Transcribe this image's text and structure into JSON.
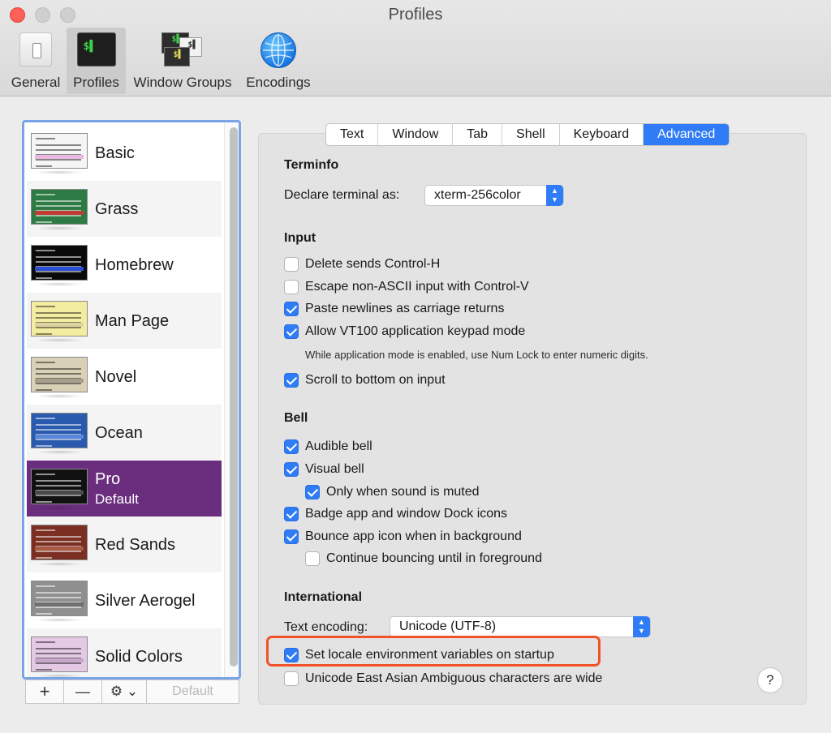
{
  "window": {
    "title": "Profiles"
  },
  "toolbar": [
    {
      "label": "General",
      "icon": "general-switch-icon"
    },
    {
      "label": "Profiles",
      "icon": "terminal-profile-icon",
      "selected": true
    },
    {
      "label": "Window Groups",
      "icon": "window-groups-icon"
    },
    {
      "label": "Encodings",
      "icon": "globe-icon"
    }
  ],
  "profiles": [
    {
      "name": "Basic",
      "bg": "#f5f5f5",
      "hl": "#e9b8e0"
    },
    {
      "name": "Grass",
      "bg": "#2e7a45",
      "hl": "#c23b33"
    },
    {
      "name": "Homebrew",
      "bg": "#0a0a0a",
      "hl": "#2a4fd6"
    },
    {
      "name": "Man Page",
      "bg": "#f2eda0",
      "hl": "#ddd2a2"
    },
    {
      "name": "Novel",
      "bg": "#d8d1b8",
      "hl": "#a8a08c"
    },
    {
      "name": "Ocean",
      "bg": "#2a5aae",
      "hl": "#5a86d8"
    },
    {
      "name": "Pro",
      "sub": "Default",
      "bg": "#111111",
      "hl": "#4a4a4a",
      "selected": true
    },
    {
      "name": "Red Sands",
      "bg": "#7a2f22",
      "hl": "#a85a44"
    },
    {
      "name": "Silver Aerogel",
      "bg": "#8f8f8f",
      "hl": "#6f6f6f"
    },
    {
      "name": "Solid Colors",
      "bg": "#e4c9e4",
      "hl": "#c7a7c7"
    }
  ],
  "list_controls": {
    "add": "+",
    "remove": "—",
    "gear": "⚙ ⌄",
    "default": "Default"
  },
  "tabs": [
    {
      "label": "Text"
    },
    {
      "label": "Window"
    },
    {
      "label": "Tab"
    },
    {
      "label": "Shell"
    },
    {
      "label": "Keyboard"
    },
    {
      "label": "Advanced",
      "selected": true
    }
  ],
  "terminfo": {
    "title": "Terminfo",
    "declare_label": "Declare terminal as:",
    "declare_value": "xterm-256color"
  },
  "input": {
    "title": "Input",
    "delete_control_h": "Delete sends Control-H",
    "escape_non_ascii": "Escape non-ASCII input with Control-V",
    "paste_newlines": "Paste newlines as carriage returns",
    "allow_vt100": "Allow VT100 application keypad mode",
    "vt100_note": "While application mode is enabled, use Num Lock to enter numeric digits.",
    "scroll_bottom": "Scroll to bottom on input"
  },
  "bell": {
    "title": "Bell",
    "audible": "Audible bell",
    "visual": "Visual bell",
    "only_muted": "Only when sound is muted",
    "badge": "Badge app and window Dock icons",
    "bounce": "Bounce app icon when in background",
    "continue_bouncing": "Continue bouncing until in foreground"
  },
  "international": {
    "title": "International",
    "encoding_label": "Text encoding:",
    "encoding_value": "Unicode (UTF-8)",
    "set_locale": "Set locale environment variables on startup",
    "east_asian": "Unicode East Asian Ambiguous characters are wide"
  },
  "help": "?",
  "colors": {
    "accent": "#2f7cf6",
    "selection": "#6b2e7e",
    "highlight": "#f0532b"
  }
}
